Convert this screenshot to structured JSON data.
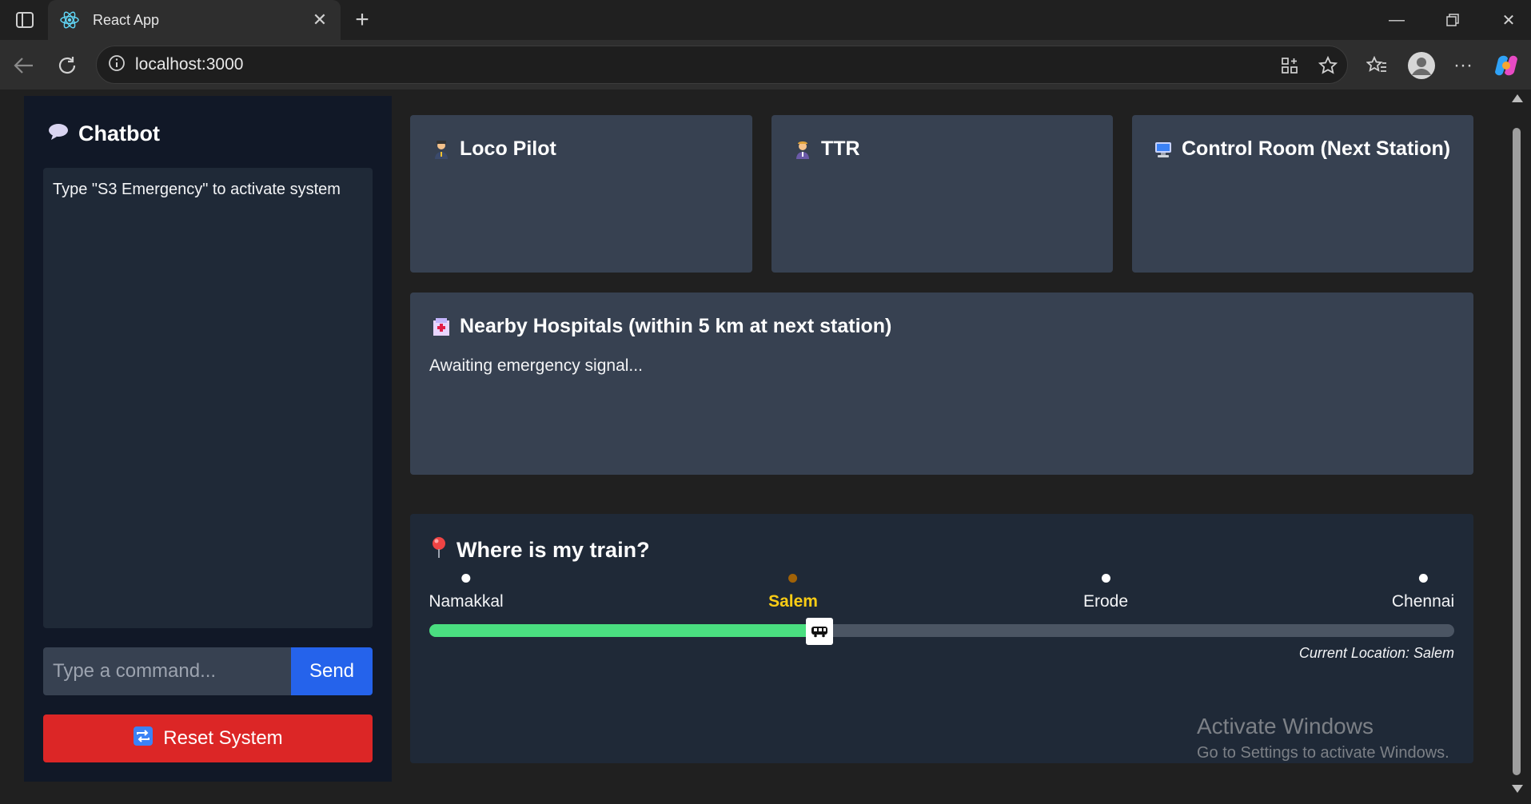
{
  "browser": {
    "tab_title": "React App",
    "url": "localhost:3000"
  },
  "chatbot": {
    "title": "Chatbot",
    "icon": "speech-balloon-icon",
    "messages": [
      "Type \"S3 Emergency\" to activate system"
    ],
    "input_placeholder": "Type a command...",
    "send_label": "Send",
    "reset_label": "Reset System",
    "reset_icon": "repeat-icon"
  },
  "cards": {
    "loco_pilot": {
      "title": "Loco Pilot",
      "icon": "pilot-icon"
    },
    "ttr": {
      "title": "TTR",
      "icon": "officer-icon"
    },
    "control_room": {
      "title": "Control Room (Next Station)",
      "icon": "computer-icon"
    }
  },
  "hospitals": {
    "title": "Nearby Hospitals (within 5 km at next station)",
    "icon": "hospital-icon",
    "status": "Awaiting emergency signal..."
  },
  "tracker": {
    "title": "Where is my train?",
    "icon": "pin-icon",
    "stations": [
      "Namakkal",
      "Salem",
      "Erode",
      "Chennai"
    ],
    "current_station": "Salem",
    "progress_fraction": 0.37,
    "current_location": "Current Location: Salem"
  },
  "watermark": {
    "line1": "Activate Windows",
    "line2": "Go to Settings to activate Windows."
  },
  "colors": {
    "panel_dark": "#111827",
    "card": "#374151",
    "send": "#2563eb",
    "reset": "#dc2626",
    "progress": "#4ade80",
    "current_station": "#facc15"
  }
}
